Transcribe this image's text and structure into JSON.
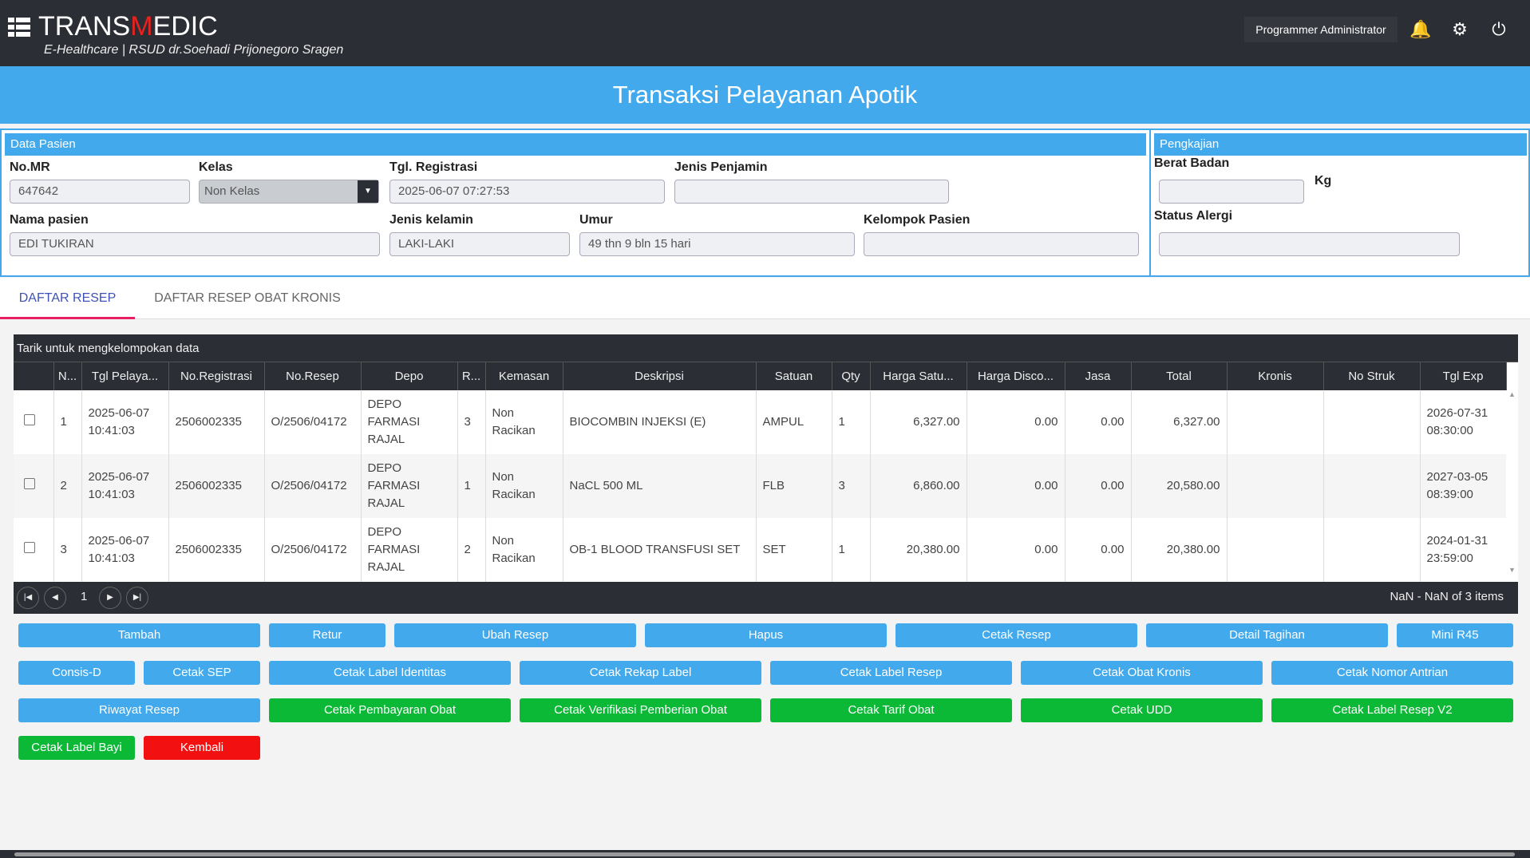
{
  "header": {
    "brand_pre": "TRANS",
    "brand_m": "M",
    "brand_post": "EDIC",
    "subtitle": "E-Healthcare | RSUD dr.Soehadi Prijonegoro Sragen",
    "user": "Programmer Administrator"
  },
  "page_title": "Transaksi Pelayanan Apotik",
  "patient": {
    "section": "Data Pasien",
    "no_mr": {
      "label": "No.MR",
      "value": "647642"
    },
    "kelas": {
      "label": "Kelas",
      "value": "Non Kelas"
    },
    "tgl_registrasi": {
      "label": "Tgl. Registrasi",
      "value": "2025-06-07 07:27:53"
    },
    "jenis_penjamin": {
      "label": "Jenis Penjamin",
      "value": ""
    },
    "nama": {
      "label": "Nama pasien",
      "value": "EDI TUKIRAN"
    },
    "jenis_kelamin": {
      "label": "Jenis kelamin",
      "value": "LAKI-LAKI"
    },
    "umur": {
      "label": "Umur",
      "value": "49 thn 9 bln 15 hari"
    },
    "kelompok": {
      "label": "Kelompok Pasien",
      "value": ""
    }
  },
  "pengkajian": {
    "section": "Pengkajian",
    "berat_label": "Berat Badan",
    "berat_unit": "Kg",
    "berat_value": "",
    "alergi_label": "Status Alergi",
    "alergi_value": ""
  },
  "tabs": [
    "DAFTAR RESEP",
    "DAFTAR RESEP OBAT KRONIS"
  ],
  "grid": {
    "group_hint": "Tarik untuk mengkelompokan data",
    "columns": [
      "N...",
      "Tgl Pelaya...",
      "No.Registrasi",
      "No.Resep",
      "Depo",
      "R...",
      "Kemasan",
      "Deskripsi",
      "Satuan",
      "Qty",
      "Harga Satu...",
      "Harga Disco...",
      "Jasa",
      "Total",
      "Kronis",
      "No Struk",
      "Tgl Exp"
    ],
    "rows": [
      [
        "1",
        "2025-06-07 10:41:03",
        "2506002335",
        "O/2506/04172",
        "DEPO FARMASI RAJAL",
        "3",
        "Non Racikan",
        "BIOCOMBIN INJEKSI (E)",
        "AMPUL",
        "1",
        "6,327.00",
        "0.00",
        "0.00",
        "6,327.00",
        "",
        "",
        "2026-07-31 08:30:00"
      ],
      [
        "2",
        "2025-06-07 10:41:03",
        "2506002335",
        "O/2506/04172",
        "DEPO FARMASI RAJAL",
        "1",
        "Non Racikan",
        "NaCL 500 ML",
        "FLB",
        "3",
        "6,860.00",
        "0.00",
        "0.00",
        "20,580.00",
        "",
        "",
        "2027-03-05 08:39:00"
      ],
      [
        "3",
        "2025-06-07 10:41:03",
        "2506002335",
        "O/2506/04172",
        "DEPO FARMASI RAJAL",
        "2",
        "Non Racikan",
        "OB-1 BLOOD TRANSFUSI SET",
        "SET",
        "1",
        "20,380.00",
        "0.00",
        "0.00",
        "20,380.00",
        "",
        "",
        "2024-01-31 23:59:00"
      ]
    ],
    "page": "1",
    "pager_info": "NaN - NaN of 3 items"
  },
  "buttons": [
    {
      "label": "Tambah",
      "span": 2,
      "c": ""
    },
    {
      "label": "Retur",
      "span": 1,
      "c": ""
    },
    {
      "label": "Ubah Resep",
      "span": 2,
      "c": ""
    },
    {
      "label": "Hapus",
      "span": 2,
      "c": ""
    },
    {
      "label": "Cetak Resep",
      "span": 2,
      "c": ""
    },
    {
      "label": "Detail Tagihan",
      "span": 2,
      "c": ""
    },
    {
      "label": "Mini R45",
      "span": 1,
      "c": ""
    },
    {
      "label": "Consis-D",
      "span": 1,
      "c": ""
    },
    {
      "label": "Cetak SEP",
      "span": 1,
      "c": ""
    },
    {
      "label": "Cetak Label Identitas",
      "span": 2,
      "c": ""
    },
    {
      "label": "Cetak Rekap Label",
      "span": 2,
      "c": ""
    },
    {
      "label": "Cetak Label Resep",
      "span": 2,
      "c": ""
    },
    {
      "label": "Cetak Obat Kronis",
      "span": 2,
      "c": ""
    },
    {
      "label": "Cetak Nomor Antrian",
      "span": 2,
      "c": ""
    },
    {
      "label": "Riwayat Resep",
      "span": 2,
      "c": ""
    },
    {
      "label": "Cetak Pembayaran Obat",
      "span": 2,
      "c": "g"
    },
    {
      "label": "Cetak Verifikasi Pemberian Obat",
      "span": 2,
      "c": "g"
    },
    {
      "label": "Cetak Tarif Obat",
      "span": 2,
      "c": "g"
    },
    {
      "label": "Cetak UDD",
      "span": 2,
      "c": "g"
    },
    {
      "label": "Cetak Label Resep V2",
      "span": 2,
      "c": "g"
    },
    {
      "label": "Cetak Label Bayi",
      "span": 2,
      "c": "g"
    },
    {
      "label": "Kembali",
      "span": 1,
      "c": "red"
    }
  ]
}
